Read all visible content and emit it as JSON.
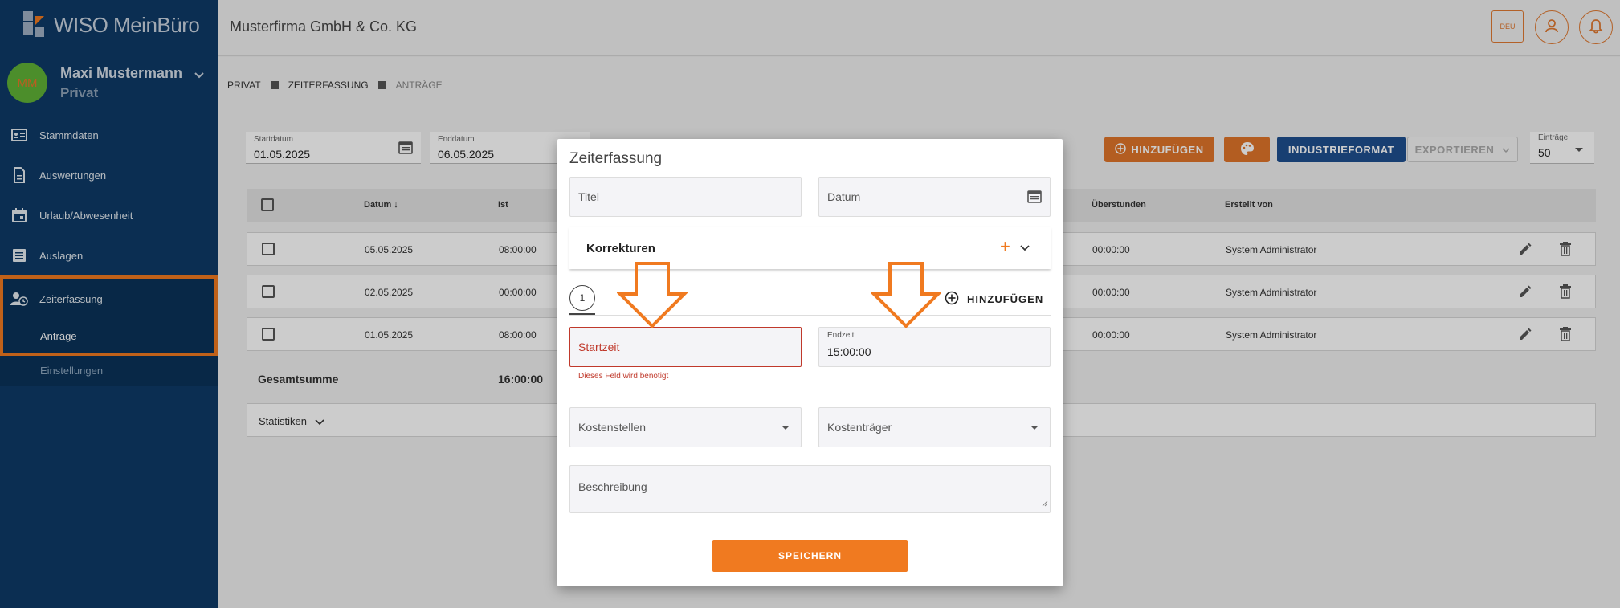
{
  "app": {
    "logo_text": "WISO MeinBüro"
  },
  "user": {
    "initials": "MM",
    "name": "Maxi Mustermann",
    "context": "Privat"
  },
  "sidebar": {
    "items": [
      {
        "label": "Stammdaten",
        "icon": "id-card-icon"
      },
      {
        "label": "Auswertungen",
        "icon": "document-icon"
      },
      {
        "label": "Urlaub/Abwesenheit",
        "icon": "calendar-icon"
      },
      {
        "label": "Auslagen",
        "icon": "list-icon"
      }
    ],
    "active": {
      "label": "Zeiterfassung",
      "icon": "user-clock-icon",
      "sub": "Anträge"
    },
    "sub2": "Einstellungen"
  },
  "topbar": {
    "company": "Musterfirma GmbH & Co. KG",
    "lang": "DEU"
  },
  "breadcrumb": [
    "PRIVAT",
    "ZEITERFASSUNG",
    "ANTRÄGE"
  ],
  "filters": {
    "start": {
      "label": "Startdatum",
      "value": "01.05.2025"
    },
    "end": {
      "label": "Enddatum",
      "value": "06.05.2025"
    }
  },
  "toolbar": {
    "add": "HINZUFÜGEN",
    "industry": "INDUSTRIEFORMAT",
    "export": "EXPORTIEREN",
    "entries_label": "Einträge",
    "entries_value": "50"
  },
  "table": {
    "headers": {
      "date": "Datum",
      "ist": "Ist",
      "overtime": "Überstunden",
      "created_by": "Erstellt von"
    },
    "rows": [
      {
        "date": "05.05.2025",
        "ist": "08:00:00",
        "overtime": "00:00:00",
        "created_by": "System Administrator"
      },
      {
        "date": "02.05.2025",
        "ist": "00:00:00",
        "overtime": "00:00:00",
        "created_by": "System Administrator"
      },
      {
        "date": "01.05.2025",
        "ist": "08:00:00",
        "overtime": "00:00:00",
        "created_by": "System Administrator"
      }
    ],
    "total_label": "Gesamtsumme",
    "total_value": "16:00:00",
    "stats_label": "Statistiken"
  },
  "modal": {
    "title": "Zeiterfassung",
    "title_field_ph": "Titel",
    "date_field_ph": "Datum",
    "corrections_title": "Korrekturen",
    "tab_number": "1",
    "add_label": "HINZUFÜGEN",
    "start_ph": "Startzeit",
    "start_error": "Dieses Feld wird benötigt",
    "end_label": "Endzeit",
    "end_value": "15:00:00",
    "cost_center_ph": "Kostenstellen",
    "cost_unit_ph": "Kostenträger",
    "description_ph": "Beschreibung",
    "save_label": "SPEICHERN"
  },
  "colors": {
    "accent": "#f07a20",
    "sidebar": "#0e3a67",
    "primary_btn": "#1f4f8f",
    "error": "#c0392b"
  }
}
